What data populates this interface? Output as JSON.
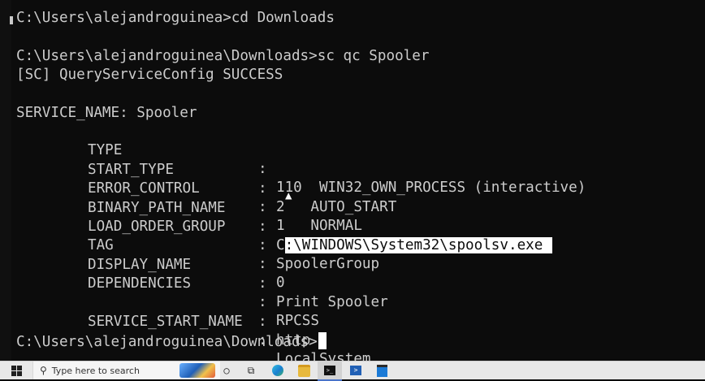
{
  "console": {
    "lines": [
      "C:\\Users\\alejandroguinea>cd Downloads",
      "C:\\Users\\alejandroguinea\\Downloads>sc qc Spooler",
      "[SC] QueryServiceConfig SUCCESS",
      "SERVICE_NAME: Spooler"
    ],
    "fields": [
      {
        "key": "TYPE",
        "sep": ":",
        "value": "110  WIN32_OWN_PROCESS (interactive)"
      },
      {
        "key": "START_TYPE",
        "sep": ":",
        "value": "2   AUTO_START"
      },
      {
        "key": "ERROR_CONTROL",
        "sep": ":",
        "value": "1   NORMAL"
      },
      {
        "key": "BINARY_PATH_NAME",
        "sep": ":",
        "value_prefix": "C",
        "value_selected": ":\\WINDOWS\\System32\\spoolsv.exe"
      },
      {
        "key": "LOAD_ORDER_GROUP",
        "sep": ":",
        "value": "SpoolerGroup"
      },
      {
        "key": "TAG",
        "sep": ":",
        "value": "0"
      },
      {
        "key": "DISPLAY_NAME",
        "sep": ":",
        "value": "Print Spooler"
      },
      {
        "key": "DEPENDENCIES",
        "sep": ":",
        "value": "RPCSS"
      },
      {
        "key": "",
        "sep": ":",
        "value": "http"
      },
      {
        "key": "SERVICE_START_NAME",
        "sep": ":",
        "value": "LocalSystem"
      }
    ],
    "prompt": "C:\\Users\\alejandroguinea\\Downloads>"
  },
  "taskbar": {
    "search_placeholder": "Type here to search",
    "icons": [
      "windows-start-icon",
      "search-icon",
      "cortana-icon",
      "task-view-icon",
      "edge-icon",
      "file-explorer-icon",
      "terminal-icon",
      "powershell-icon",
      "store-icon"
    ]
  },
  "colors": {
    "console_bg": "#0c0c0c",
    "console_fg": "#cccccc",
    "selection_bg": "#ffffff",
    "taskbar_bg": "#e8e8e8"
  }
}
